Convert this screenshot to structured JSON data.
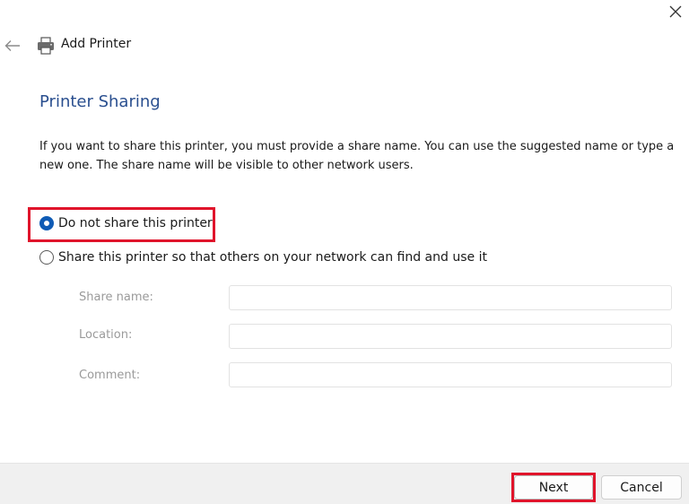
{
  "window": {
    "title": "Add Printer"
  },
  "icons": {
    "close": "close-icon",
    "back": "back-arrow-icon",
    "printer": "printer-icon"
  },
  "colors": {
    "heading": "#2a4f8f",
    "radio_accent": "#0f5bb5",
    "highlight": "#e0142b",
    "footer_bg": "#f0f0f0"
  },
  "page": {
    "heading": "Printer Sharing",
    "description": "If you want to share this printer, you must provide a share name. You can use the suggested name or type a new one. The share name will be visible to other network users."
  },
  "options": {
    "no_share": {
      "label": "Do not share this printer",
      "selected": true
    },
    "share": {
      "label": "Share this printer so that others on your network can find and use it",
      "selected": false
    }
  },
  "fields": {
    "share_name": {
      "label": "Share name:",
      "value": ""
    },
    "location": {
      "label": "Location:",
      "value": ""
    },
    "comment": {
      "label": "Comment:",
      "value": ""
    }
  },
  "footer": {
    "next_label": "Next",
    "cancel_label": "Cancel"
  }
}
